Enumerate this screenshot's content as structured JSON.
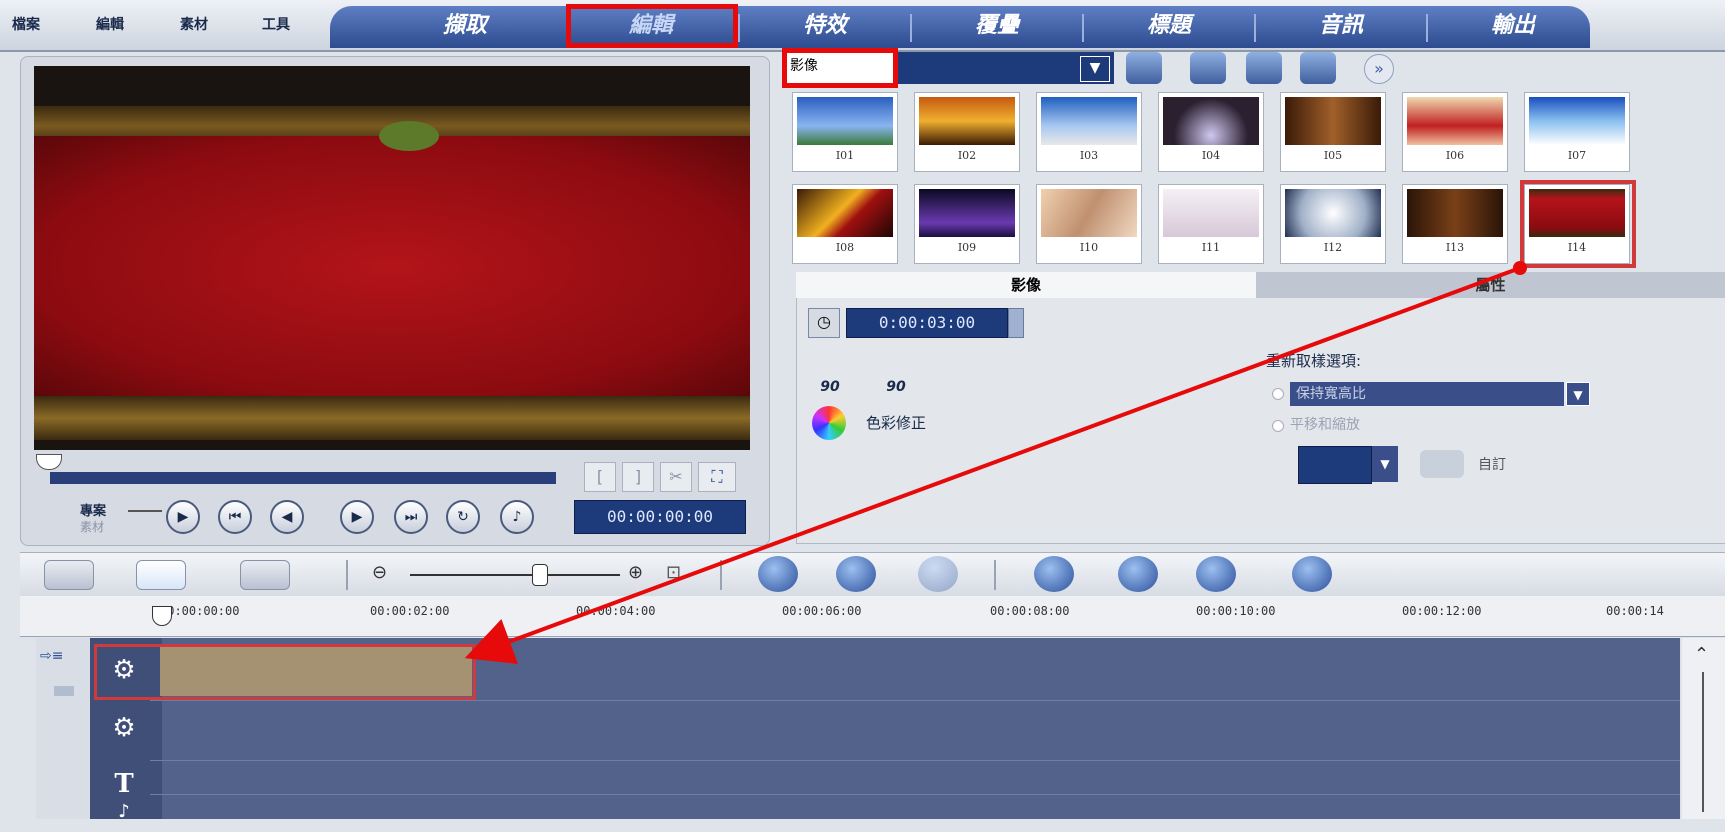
{
  "menu": [
    "檔案",
    "編輯",
    "素材",
    "工具"
  ],
  "tabs": [
    "擷取",
    "編輯",
    "特效",
    "覆疊",
    "標題",
    "音訊",
    "輸出"
  ],
  "preview": {
    "mode_project": "專案",
    "mode_clip": "素材",
    "timecode": "00:00:00:00"
  },
  "library": {
    "category": "影像",
    "thumbnails": [
      "I01",
      "I02",
      "I03",
      "I04",
      "I05",
      "I06",
      "I07",
      "I08",
      "I09",
      "I10",
      "I11",
      "I12",
      "I13",
      "I14"
    ]
  },
  "options": {
    "tab_image": "影像",
    "tab_attributes": "屬性",
    "duration": "0:00:03:00",
    "rotate_left": "90",
    "rotate_right": "90",
    "color_correction": "色彩修正",
    "resample_label": "重新取樣選項:",
    "resample_keep": "保持寬高比",
    "pan_zoom": "平移和縮放",
    "custom": "自訂"
  },
  "timeline": {
    "ticks": [
      "00:00:00:00",
      "00:00:02:00",
      "00:00:04:00",
      "00:00:06:00",
      "00:00:08:00",
      "00:00:10:00",
      "00:00:12:00",
      "00:00:14"
    ],
    "title_track_icon": "T"
  },
  "colors": {
    "highlight": "#e60a0a",
    "tab_bg": "#2d4b8f"
  }
}
